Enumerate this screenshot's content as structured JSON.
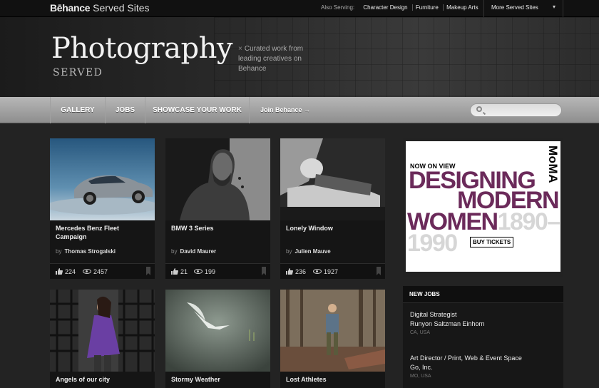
{
  "topbar": {
    "brand_bold": "Bēhance",
    "brand_rest": " Served Sites",
    "also_label": "Also Serving:",
    "also_links": [
      "Character Design",
      "Furniture",
      "Makeup Arts"
    ],
    "more_label": "More Served Sites"
  },
  "hero": {
    "title": "Photography",
    "subtitle": "SERVED",
    "tagline": "Curated work from leading creatives on Behance"
  },
  "nav": {
    "items": [
      "GALLERY",
      "JOBS",
      "SHOWCASE YOUR WORK"
    ],
    "join": "Join Behance →",
    "search_placeholder": ""
  },
  "cards": [
    {
      "title": "Mercedes Benz Fleet Campaign",
      "by": "by",
      "author": "Thomas Strogalski",
      "likes": "224",
      "views": "2457"
    },
    {
      "title": "BMW 3 Series",
      "by": "by",
      "author": "David Maurer",
      "likes": "21",
      "views": "199"
    },
    {
      "title": "Lonely Window",
      "by": "by",
      "author": "Julien Mauve",
      "likes": "236",
      "views": "1927"
    },
    {
      "title": "Angels of our city"
    },
    {
      "title": "Stormy Weather"
    },
    {
      "title": "Lost Athletes"
    }
  ],
  "ad": {
    "brand": "MoMA",
    "now": "NOW ON VIEW",
    "line1": "DESIGNING",
    "line2": "MODERN",
    "line3a": "WOMEN",
    "line3b": "1890–",
    "line4": "1990",
    "cta": "BUY TICKETS"
  },
  "jobs": {
    "heading": "NEW JOBS",
    "items": [
      {
        "title": "Digital Strategist",
        "company": "Runyon Saltzman Einhorn",
        "location": "CA, USA"
      },
      {
        "title": "Art Director / Print, Web & Event Space",
        "company": "Go, Inc.",
        "location": "MO, USA"
      }
    ]
  },
  "colors": {
    "accent_purple": "#6b2a5a",
    "nav_gray": "#a6a6a6",
    "background": "#232323"
  }
}
